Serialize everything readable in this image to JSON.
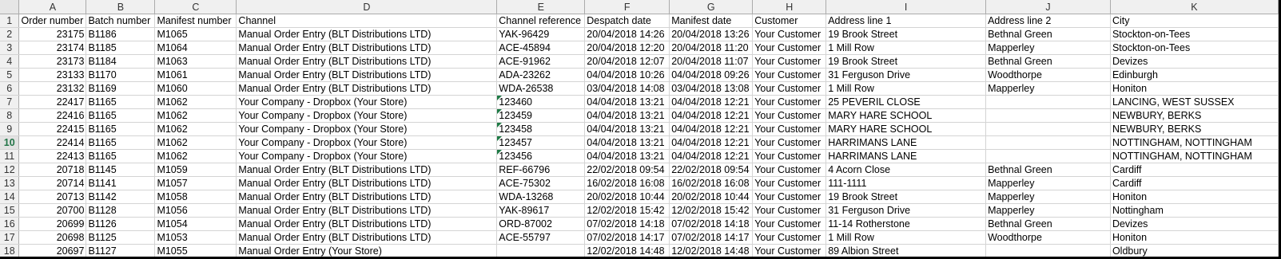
{
  "columns": [
    "A",
    "B",
    "C",
    "D",
    "E",
    "F",
    "G",
    "H",
    "I",
    "J",
    "K"
  ],
  "headers": [
    "Order number",
    "Batch number",
    "Manifest number",
    "Channel",
    "Channel reference",
    "Despatch date",
    "Manifest date",
    "Customer",
    "Address line 1",
    "Address line 2",
    "City"
  ],
  "header_row_number": "1",
  "rows": [
    {
      "n": "2",
      "cells": [
        "23175",
        "B1186",
        "M1065",
        "Manual Order Entry (BLT Distributions LTD)",
        "YAK-96429",
        "20/04/2018 14:26",
        "20/04/2018 13:26",
        "Your Customer",
        "19 Brook Street",
        "Bethnal Green",
        "Stockton-on-Tees"
      ]
    },
    {
      "n": "3",
      "cells": [
        "23174",
        "B1185",
        "M1064",
        "Manual Order Entry (BLT Distributions LTD)",
        "ACE-45894",
        "20/04/2018 12:20",
        "20/04/2018 11:20",
        "Your Customer",
        "1 Mill Row",
        "Mapperley",
        "Stockton-on-Tees"
      ]
    },
    {
      "n": "4",
      "cells": [
        "23173",
        "B1184",
        "M1063",
        "Manual Order Entry (BLT Distributions LTD)",
        "ACE-91962",
        "20/04/2018 12:07",
        "20/04/2018 11:07",
        "Your Customer",
        "19 Brook Street",
        "Bethnal Green",
        "Devizes"
      ]
    },
    {
      "n": "5",
      "cells": [
        "23133",
        "B1170",
        "M1061",
        "Manual Order Entry (BLT Distributions LTD)",
        "ADA-23262",
        "04/04/2018 10:26",
        "04/04/2018 09:26",
        "Your Customer",
        "31 Ferguson Drive",
        "Woodthorpe",
        "Edinburgh"
      ]
    },
    {
      "n": "6",
      "cells": [
        "23132",
        "B1169",
        "M1060",
        "Manual Order Entry (BLT Distributions LTD)",
        "WDA-26538",
        "03/04/2018 14:08",
        "03/04/2018 13:08",
        "Your Customer",
        "1 Mill Row",
        "Mapperley",
        "Honiton"
      ]
    },
    {
      "n": "7",
      "cells": [
        "22417",
        "B1165",
        "M1062",
        "Your Company - Dropbox (Your Store)",
        "123460",
        "04/04/2018 13:21",
        "04/04/2018 12:21",
        "Your Customer",
        "25 PEVERIL CLOSE",
        "",
        "LANCING, WEST SUSSEX"
      ]
    },
    {
      "n": "8",
      "cells": [
        "22416",
        "B1165",
        "M1062",
        "Your Company - Dropbox (Your Store)",
        "123459",
        "04/04/2018 13:21",
        "04/04/2018 12:21",
        "Your Customer",
        "MARY HARE SCHOOL",
        "",
        "NEWBURY, BERKS"
      ]
    },
    {
      "n": "9",
      "cells": [
        "22415",
        "B1165",
        "M1062",
        "Your Company - Dropbox (Your Store)",
        "123458",
        "04/04/2018 13:21",
        "04/04/2018 12:21",
        "Your Customer",
        "MARY HARE SCHOOL",
        "",
        "NEWBURY, BERKS"
      ]
    },
    {
      "n": "10",
      "cells": [
        "22414",
        "B1165",
        "M1062",
        "Your Company - Dropbox (Your Store)",
        "123457",
        "04/04/2018 13:21",
        "04/04/2018 12:21",
        "Your Customer",
        "HARRIMANS LANE",
        "",
        "NOTTINGHAM, NOTTINGHAM"
      ]
    },
    {
      "n": "11",
      "cells": [
        "22413",
        "B1165",
        "M1062",
        "Your Company - Dropbox (Your Store)",
        "123456",
        "04/04/2018 13:21",
        "04/04/2018 12:21",
        "Your Customer",
        "HARRIMANS LANE",
        "",
        "NOTTINGHAM, NOTTINGHAM"
      ]
    },
    {
      "n": "12",
      "cells": [
        "20718",
        "B1145",
        "M1059",
        "Manual Order Entry (BLT Distributions LTD)",
        "REF-66796",
        "22/02/2018 09:54",
        "22/02/2018 09:54",
        "Your Customer",
        "4 Acorn Close",
        "Bethnal Green",
        "Cardiff"
      ]
    },
    {
      "n": "13",
      "cells": [
        "20714",
        "B1141",
        "M1057",
        "Manual Order Entry (BLT Distributions LTD)",
        "ACE-75302",
        "16/02/2018 16:08",
        "16/02/2018 16:08",
        "Your Customer",
        "111-1111",
        "Mapperley",
        "Cardiff"
      ]
    },
    {
      "n": "14",
      "cells": [
        "20713",
        "B1142",
        "M1058",
        "Manual Order Entry (BLT Distributions LTD)",
        "WDA-13268",
        "20/02/2018 10:44",
        "20/02/2018 10:44",
        "Your Customer",
        "19 Brook Street",
        "Mapperley",
        "Honiton"
      ]
    },
    {
      "n": "15",
      "cells": [
        "20700",
        "B1128",
        "M1056",
        "Manual Order Entry (BLT Distributions LTD)",
        "YAK-89617",
        "12/02/2018 15:42",
        "12/02/2018 15:42",
        "Your Customer",
        "31 Ferguson Drive",
        "Mapperley",
        "Nottingham"
      ]
    },
    {
      "n": "16",
      "cells": [
        "20699",
        "B1126",
        "M1054",
        "Manual Order Entry (BLT Distributions LTD)",
        "ORD-87002",
        "07/02/2018 14:18",
        "07/02/2018 14:18",
        "Your Customer",
        "11-14 Rotherstone",
        "Bethnal Green",
        "Devizes"
      ]
    },
    {
      "n": "17",
      "cells": [
        "20698",
        "B1125",
        "M1053",
        "Manual Order Entry (BLT Distributions LTD)",
        "ACE-55797",
        "07/02/2018 14:17",
        "07/02/2018 14:17",
        "Your Customer",
        "1 Mill Row",
        "Woodthorpe",
        "Honiton"
      ]
    },
    {
      "n": "18",
      "cells": [
        "20697",
        "B1127",
        "M1055",
        "Manual Order Entry (Your Store)",
        "",
        "12/02/2018 14:48",
        "12/02/2018 14:48",
        "Your Customer",
        "89 Albion Street",
        "",
        "Oldbury"
      ]
    }
  ],
  "selected_row": "10",
  "text_number_rows": [
    "7",
    "8",
    "9",
    "10",
    "11"
  ],
  "colors": {
    "header_bg": "#f0f0f0",
    "grid": "#d4d4d4",
    "selected_row_header": "#217346",
    "error_triangle": "#1e7a45"
  }
}
